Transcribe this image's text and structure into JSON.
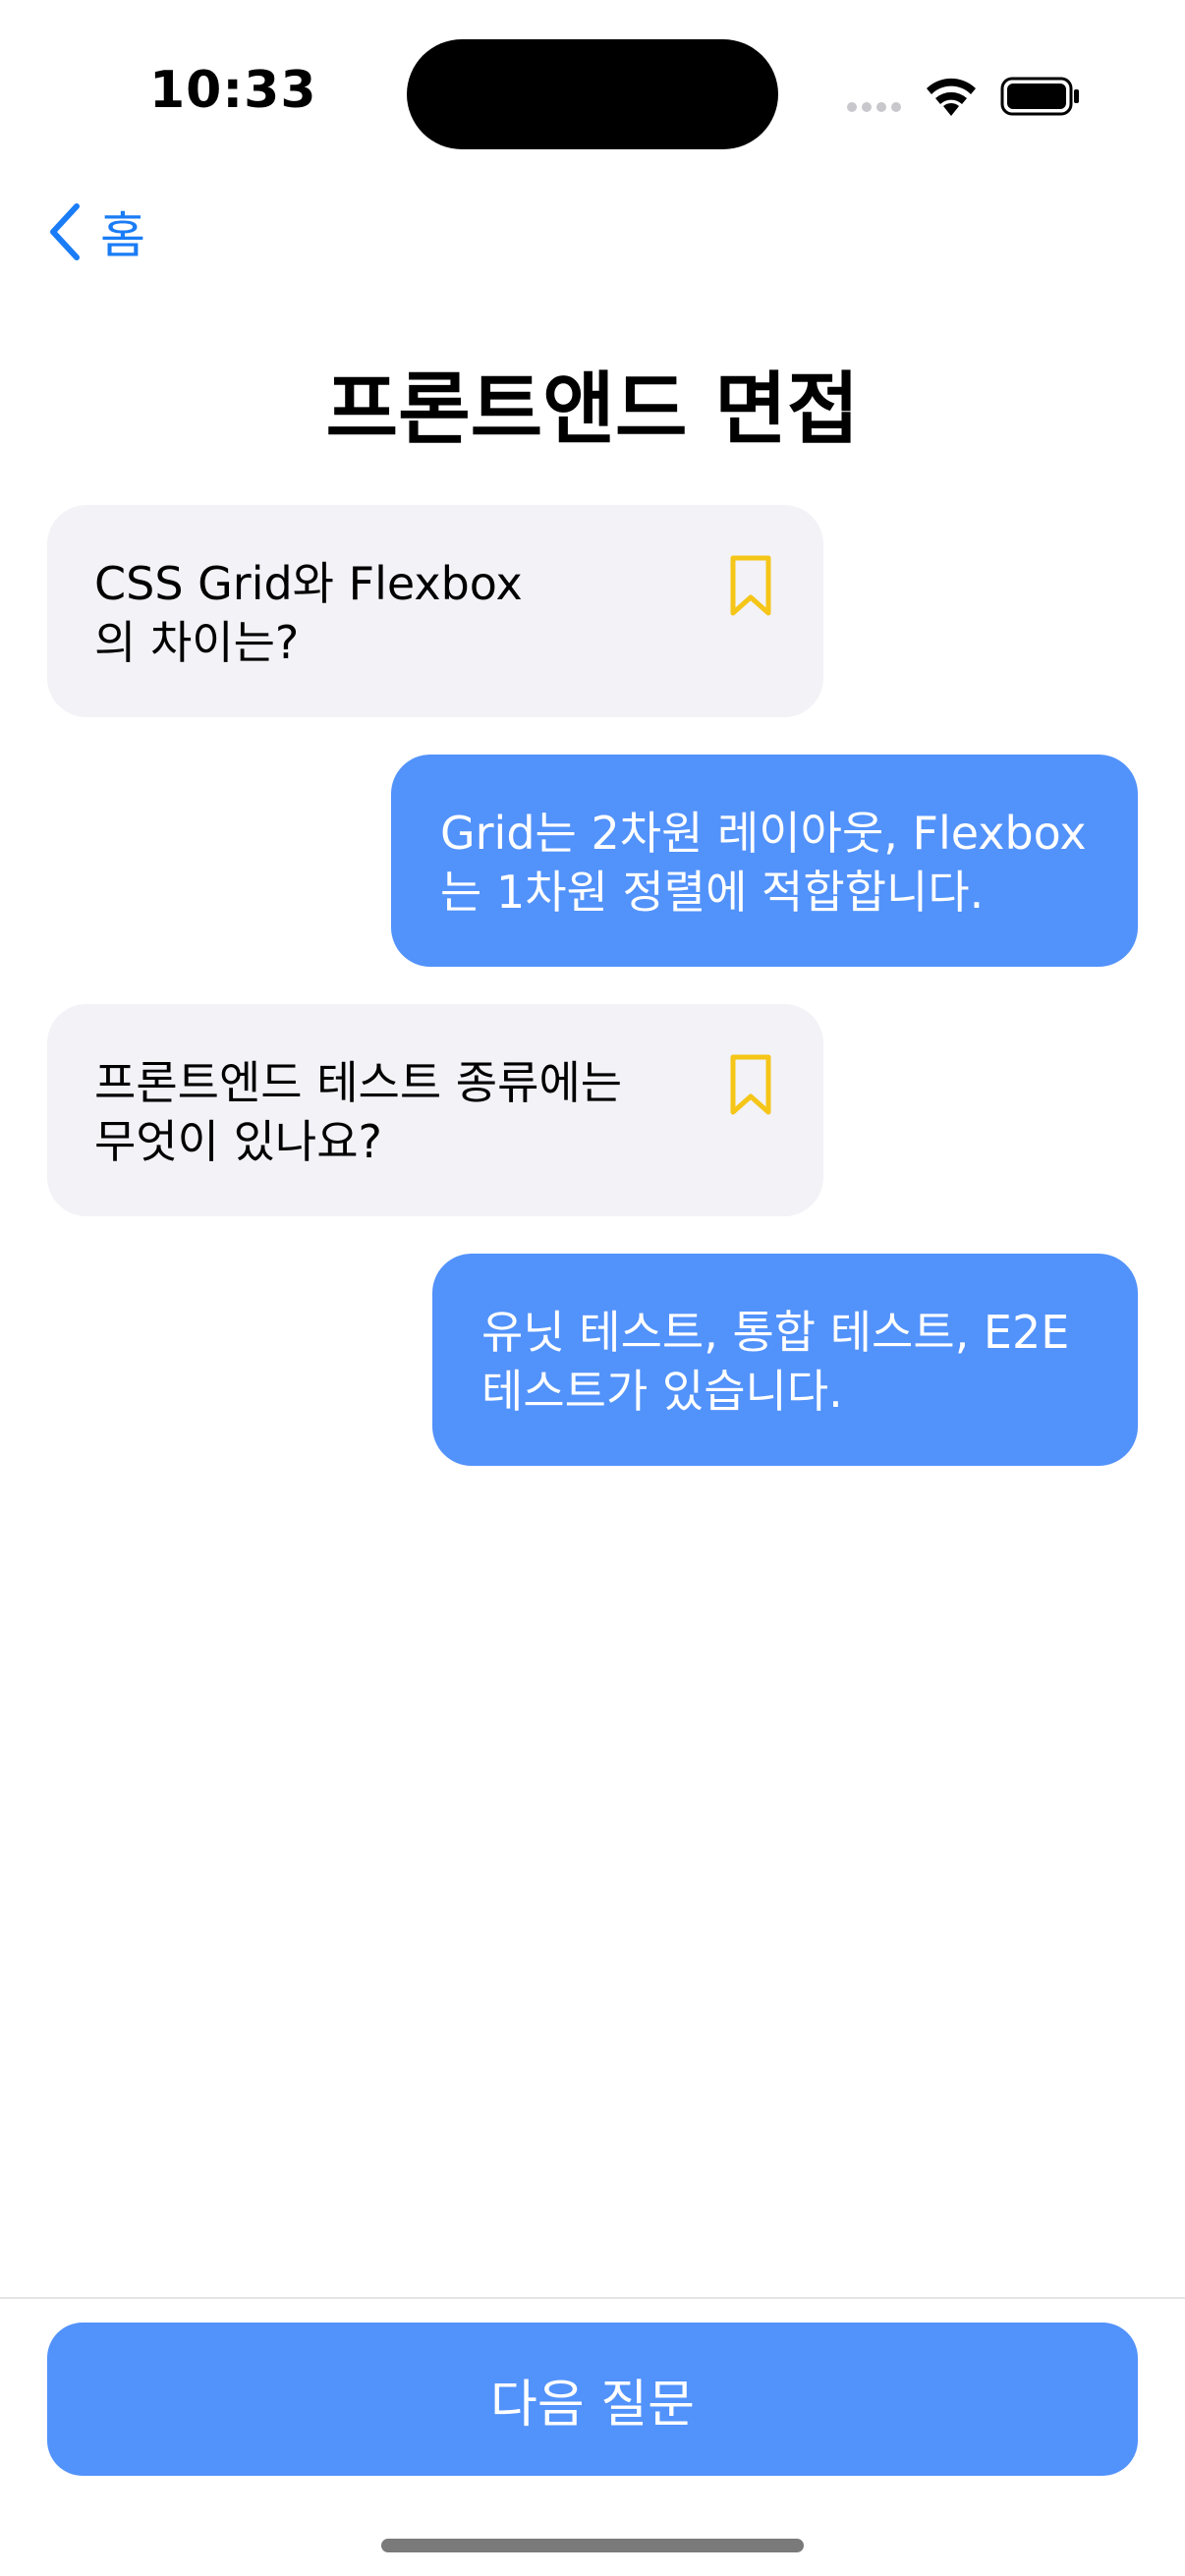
{
  "status_bar": {
    "time": "10:33"
  },
  "nav": {
    "back_label": "홈",
    "title": "프론트앤드 면접"
  },
  "messages": [
    {
      "role": "question",
      "text": "CSS Grid와 Flexbox\n의 차이는?",
      "icon": "bookmark-icon"
    },
    {
      "role": "answer",
      "text": "Grid는 2차원 레이아웃, Flexbox\n는 1차원 정렬에 적합합니다."
    },
    {
      "role": "question",
      "text": "프론트엔드 테스트 종류에는\n무엇이 있나요?",
      "icon": "bookmark-icon"
    },
    {
      "role": "answer",
      "text": "유닛 테스트, 통합 테스트, E2E\n테스트가 있습니다."
    }
  ],
  "footer": {
    "next_label": "다음 질문"
  },
  "colors": {
    "accent": "#5292fb",
    "link": "#1a7cf6",
    "bookmark": "#f5c518",
    "question_bg": "#f2f2f7"
  }
}
